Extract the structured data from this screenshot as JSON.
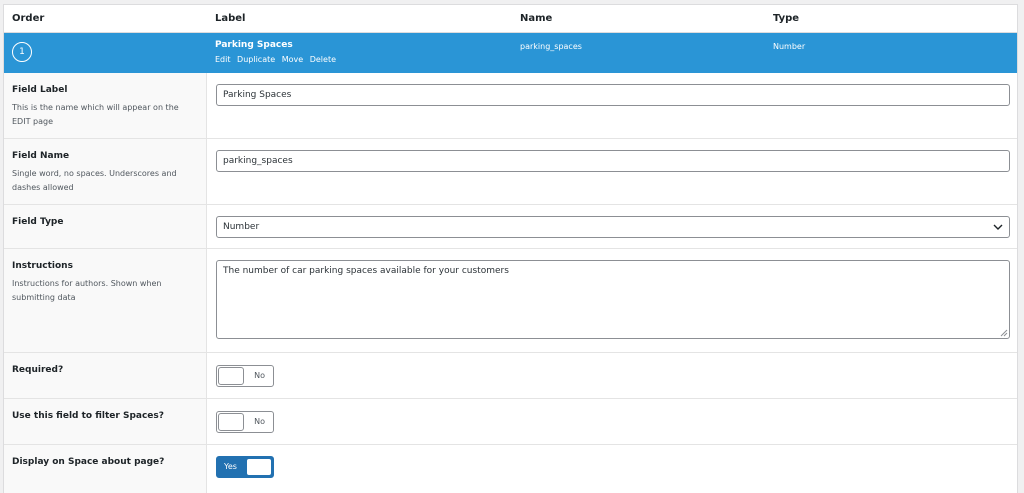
{
  "header": {
    "order": "Order",
    "label": "Label",
    "name": "Name",
    "type": "Type"
  },
  "field": {
    "order": "1",
    "label": "Parking Spaces",
    "name": "parking_spaces",
    "type": "Number",
    "actions": [
      "Edit",
      "Duplicate",
      "Move",
      "Delete"
    ]
  },
  "settings": {
    "field_label": {
      "title": "Field Label",
      "description": "This is the name which will appear on the EDIT page",
      "value": "Parking Spaces"
    },
    "field_name": {
      "title": "Field Name",
      "description": "Single word, no spaces. Underscores and dashes allowed",
      "value": "parking_spaces"
    },
    "field_type": {
      "title": "Field Type",
      "value": "Number"
    },
    "instructions": {
      "title": "Instructions",
      "description": "Instructions for authors. Shown when submitting data",
      "value": "The number of car parking spaces available for your customers"
    },
    "required": {
      "title": "Required?",
      "state": "No",
      "on": false
    },
    "filter": {
      "title": "Use this field to filter Spaces?",
      "state": "No",
      "on": false
    },
    "display": {
      "title": "Display on Space about page?",
      "state": "Yes",
      "on": true
    }
  },
  "colors": {
    "accent_bar": "#2a95d6",
    "toggle_on": "#2271b1"
  },
  "icons": {
    "select": "chevron-down-icon",
    "textarea": "resize-grip-icon"
  }
}
